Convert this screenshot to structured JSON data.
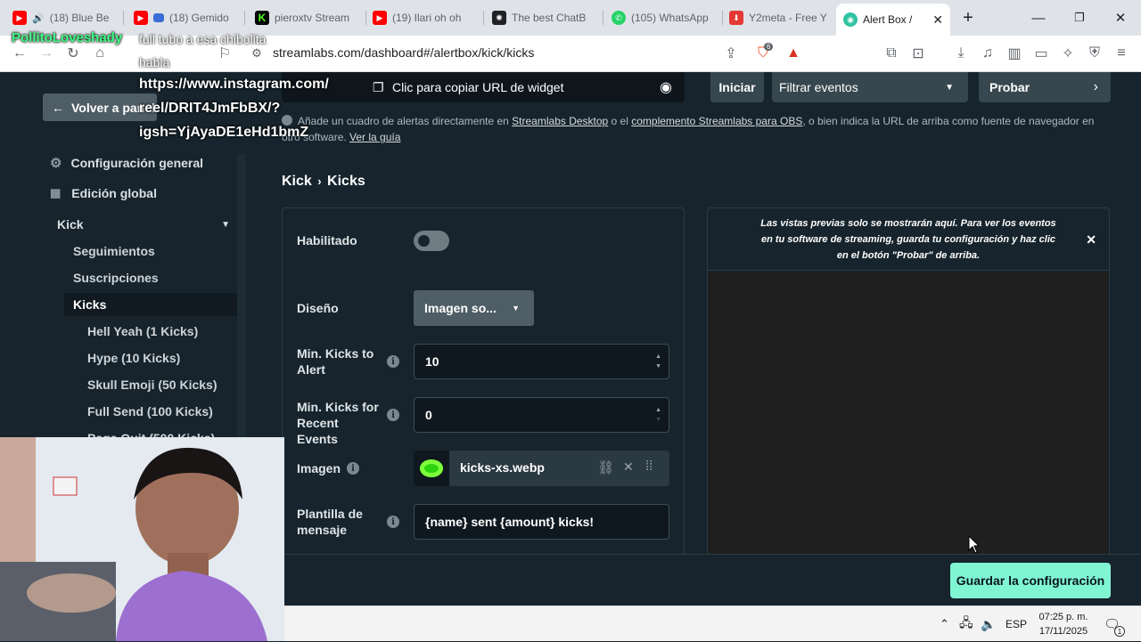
{
  "browser": {
    "tabs": [
      {
        "label": "(18) Blue Be",
        "icon": "youtube-icon",
        "color": "#ff0000"
      },
      {
        "label": "(18) Gemido",
        "icon": "youtube-icon",
        "color": "#ff0000"
      },
      {
        "label": "pieroxtv Stream",
        "icon": "kick-icon",
        "color": "#53fc18"
      },
      {
        "label": "(19) Ilari oh oh",
        "icon": "youtube-icon",
        "color": "#ff0000"
      },
      {
        "label": "The best ChatB",
        "icon": "chatgpt-icon",
        "color": "#202124"
      },
      {
        "label": "(105) WhatsApp",
        "icon": "whatsapp-icon",
        "color": "#25d366"
      },
      {
        "label": "Y2meta - Free Y",
        "icon": "y2meta-icon",
        "color": "#e53935"
      },
      {
        "label": "Alert Box /",
        "icon": "streamlabs-icon",
        "color": "#31c3a2"
      }
    ],
    "url": "streamlabs.com/dashboard#/alertbox/kick/kicks",
    "brave_badge": "6"
  },
  "sidebar": {
    "back_label": "Volver a panel",
    "items": [
      {
        "label": "Configuración general",
        "icon": "gear-icon"
      },
      {
        "label": "Edición global",
        "icon": "grid-icon"
      }
    ],
    "section": "Kick",
    "sub_items": [
      "Seguimientos",
      "Suscripciones",
      "Kicks"
    ],
    "kick_items": [
      "Hell Yeah (1 Kicks)",
      "Hype (10 Kicks)",
      "Skull Emoji (50 Kicks)",
      "Full Send (100 Kicks)",
      "Page Quit (500 Kicks)"
    ]
  },
  "topbar": {
    "copy_url_label": "Clic para copiar URL de widget",
    "start_label": "Iniciar",
    "filter_label": "Filtrar eventos",
    "test_label": "Probar"
  },
  "info": {
    "text_1": "Añade un cuadro de alertas directamente en ",
    "link_1": "Streamlabs Desktop",
    "text_2": " o el ",
    "link_2": "complemento Streamlabs para OBS",
    "text_3": ", o bien indica la URL de arriba como fuente de navegador en otro software. ",
    "link_3": "Ver la guía"
  },
  "breadcrumb": {
    "parent": "Kick",
    "current": "Kicks"
  },
  "settings": {
    "enabled_label": "Habilitado",
    "enabled": false,
    "design_label": "Diseño",
    "design_value": "Imagen so...",
    "min_kicks_alert_label": "Min. Kicks to Alert",
    "min_kicks_alert_value": "10",
    "min_kicks_recent_label": "Min. Kicks for Recent Events",
    "min_kicks_recent_value": "0",
    "image_label": "Imagen",
    "image_file": "kicks-xs.webp",
    "message_label": "Plantilla de mensaje",
    "message_value": "{name} sent {amount} kicks!"
  },
  "preview": {
    "note": "Las vistas previas solo se mostrarán aquí. Para ver los eventos en tu software de streaming, guarda tu configuración y haz clic en el botón \"Probar\" de arriba."
  },
  "save_label": "Guardar la configuración",
  "taskbar": {
    "lang": "ESP",
    "time": "07:25 p. m.",
    "date": "17/11/2025",
    "notif_count": "1"
  },
  "overlay": {
    "username": "PollitoLoveshady",
    "chat_text_1": "full tubo a esa chibolita",
    "chat_text_2": "habla",
    "link_line_1": "https://www.instagram.com/",
    "link_line_2": "reel/DRIT4JmFbBX/?",
    "link_line_3": "igsh=YjAyaDE1eHd1bmZ"
  },
  "colors": {
    "accent": "#80f5d2",
    "background": "#17242d",
    "panel": "#37474f"
  }
}
